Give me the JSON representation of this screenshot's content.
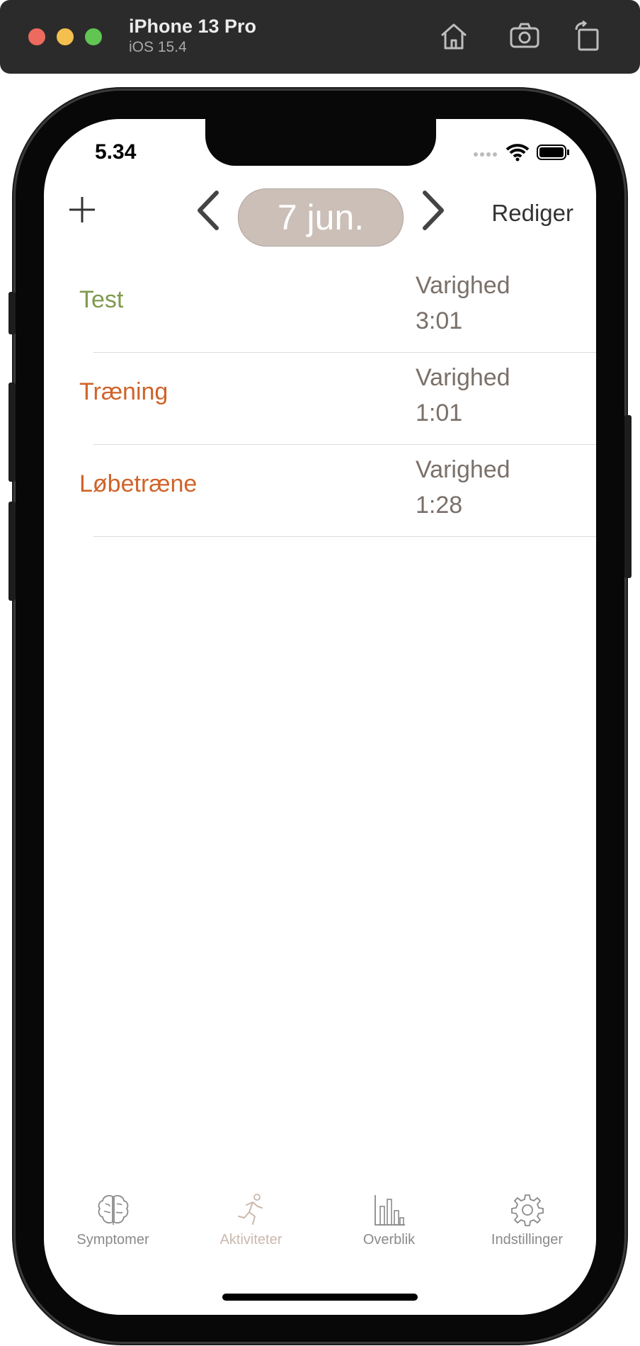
{
  "simulator": {
    "device_name": "iPhone 13 Pro",
    "os_version": "iOS 15.4",
    "icons": [
      "home-icon",
      "screenshot-icon",
      "rotate-icon"
    ]
  },
  "status_bar": {
    "time": "5.34"
  },
  "nav": {
    "add_icon": "plus-icon",
    "date_label": "7 jun.",
    "edit_label": "Rediger"
  },
  "activities": [
    {
      "name": "Test",
      "duration_label": "Varighed",
      "duration": "3:01",
      "color": "#7f9a4f"
    },
    {
      "name": "Træning",
      "duration_label": "Varighed",
      "duration": "1:01",
      "color": "#d06328"
    },
    {
      "name": "Løbetræne",
      "duration_label": "Varighed",
      "duration": "1:28",
      "color": "#d06328"
    }
  ],
  "tabs": [
    {
      "label": "Symptomer",
      "icon": "brain-icon",
      "active": false
    },
    {
      "label": "Aktiviteter",
      "icon": "running-person-icon",
      "active": true
    },
    {
      "label": "Overblik",
      "icon": "bar-chart-icon",
      "active": false
    },
    {
      "label": "Indstillinger",
      "icon": "gear-icon",
      "active": false
    }
  ],
  "colors": {
    "accent": "#cbbfb8",
    "active_tab": "#cbb8ad"
  }
}
